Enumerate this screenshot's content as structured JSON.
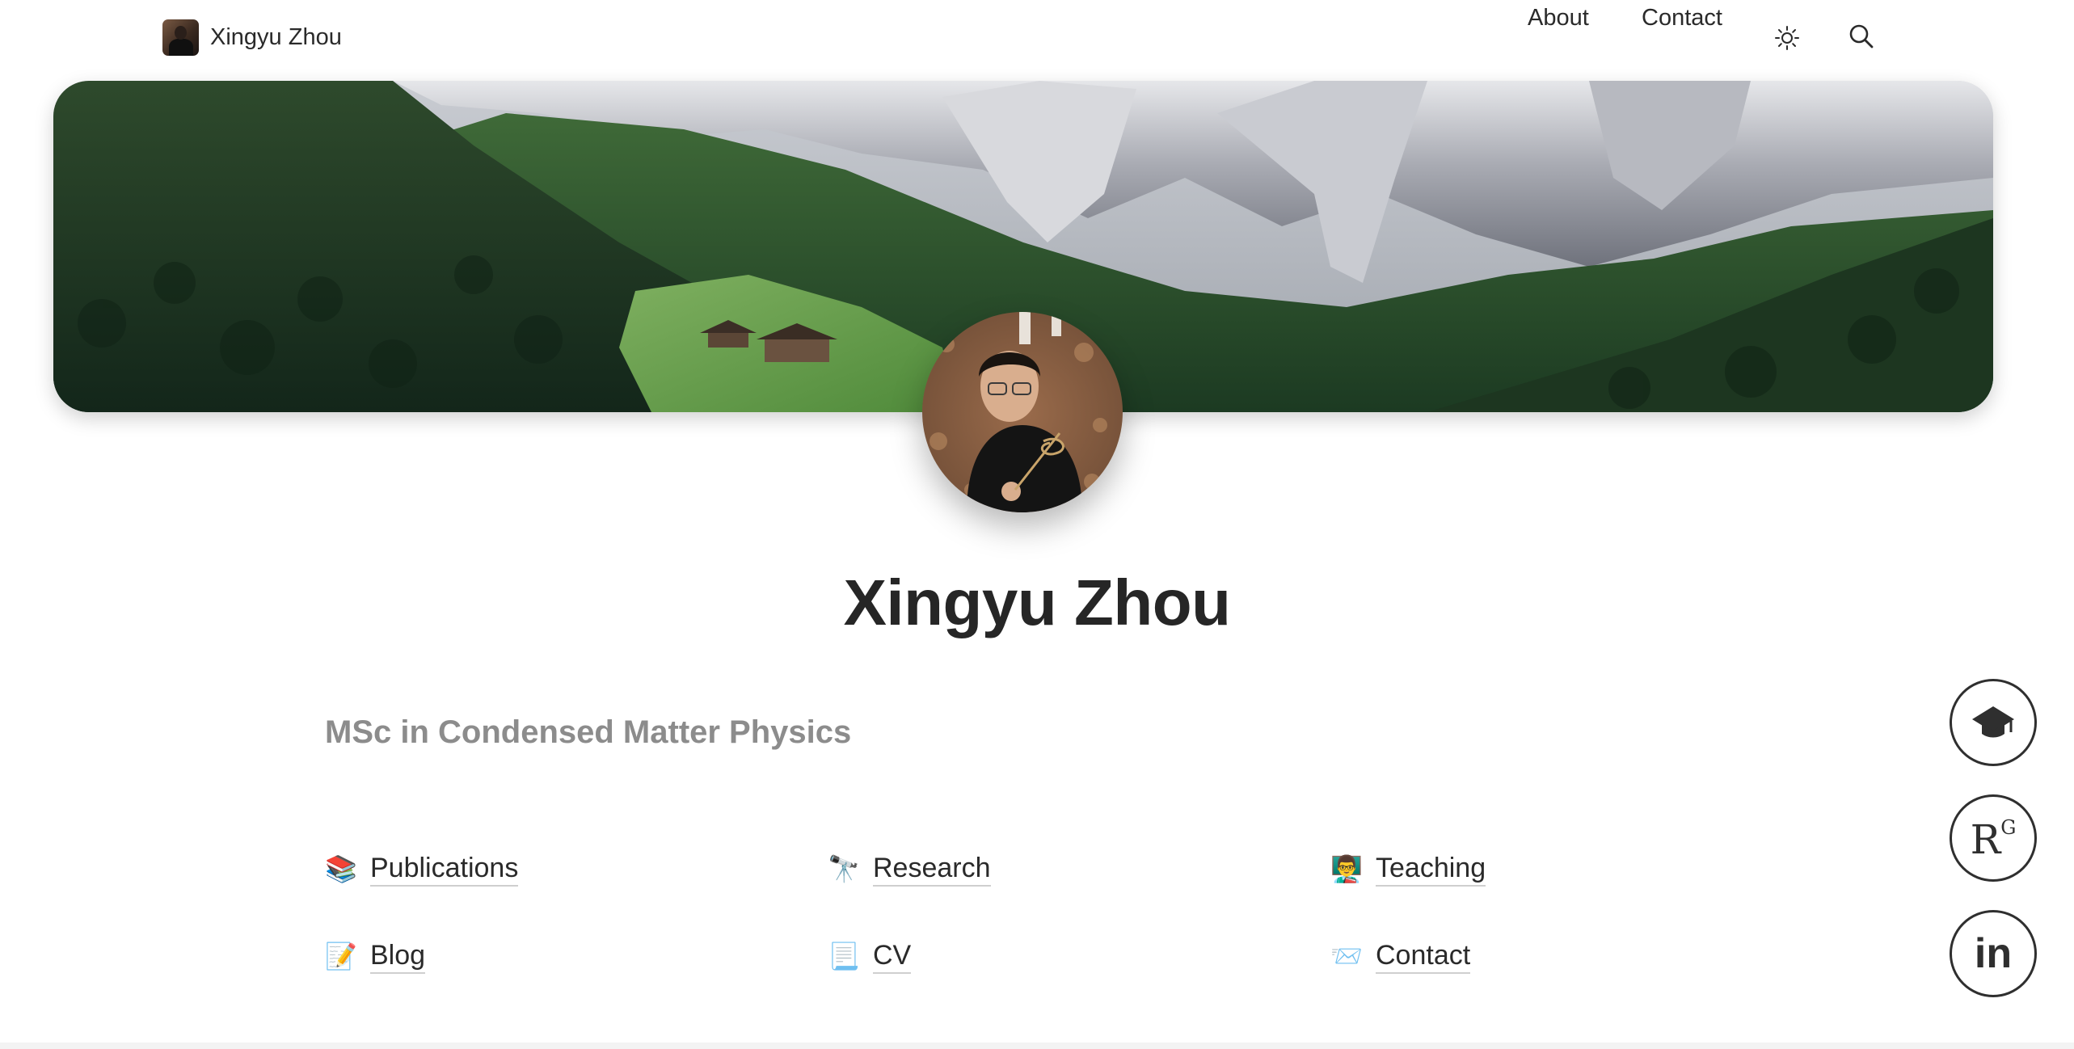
{
  "nav": {
    "brand_name": "Xingyu Zhou",
    "links": [
      "About",
      "Contact"
    ],
    "icons": [
      "sun-icon",
      "search-icon"
    ]
  },
  "profile": {
    "name": "Xingyu Zhou",
    "subtitle": "MSc in Condensed Matter Physics"
  },
  "links": [
    {
      "emoji": "📚",
      "label": "Publications"
    },
    {
      "emoji": "🔭",
      "label": "Research"
    },
    {
      "emoji": "👨‍🏫",
      "label": "Teaching"
    },
    {
      "emoji": "📝",
      "label": "Blog"
    },
    {
      "emoji": "📃",
      "label": "CV"
    },
    {
      "emoji": "📨",
      "label": "Contact"
    }
  ],
  "social": [
    {
      "icon": "google-scholar-icon"
    },
    {
      "icon": "researchgate-icon",
      "text": "R",
      "sup": "G"
    },
    {
      "icon": "linkedin-icon",
      "text": "in"
    }
  ],
  "colors": {
    "text": "#2a2a2a",
    "subtitle": "#8c8c8c",
    "underline": "#cfcfcf"
  }
}
